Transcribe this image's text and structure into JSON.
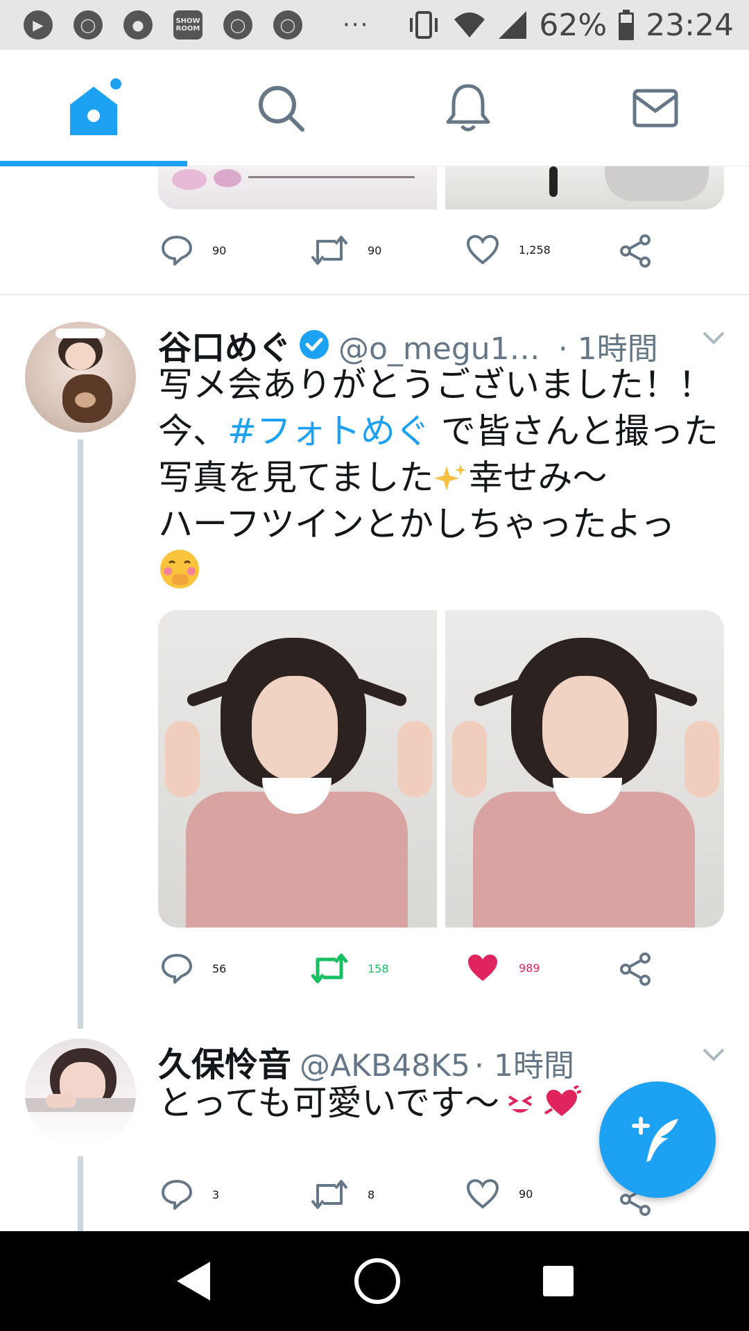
{
  "status_bar": {
    "battery": "62%",
    "time": "23:24",
    "notification_icons": [
      "play-store-icon",
      "chrome-icon",
      "dog-app-icon",
      "showroom-icon",
      "chrome-icon",
      "chrome-icon"
    ],
    "showroom_label": "SHOW ROOM",
    "overflow": "···"
  },
  "tabs": [
    {
      "icon": "home-icon",
      "active": true
    },
    {
      "icon": "search-icon",
      "active": false
    },
    {
      "icon": "bell-icon",
      "active": false
    },
    {
      "icon": "mail-icon",
      "active": false
    }
  ],
  "prev_tweet": {
    "replies": "90",
    "retweets": "90",
    "likes": "1,258"
  },
  "tweet1": {
    "name": "谷口めぐ",
    "verified": true,
    "handle": "@o_megu1…",
    "time": "· 1時間",
    "text_line1": "写メ会ありがとうございました！！",
    "text_line2_pre": "今、",
    "hashtag": "#フォトめぐ",
    "text_line2_post": " で皆さんと撮った",
    "text_line3": "写真を見てました",
    "text_line3_post": "幸せみ〜",
    "text_line4": "ハーフツインとかしちゃったよっ",
    "replies": "56",
    "retweets": "158",
    "likes": "989",
    "retweeted": true,
    "liked": true
  },
  "tweet2": {
    "name": "久保怜音",
    "handle": "@AKB48K5",
    "time": "· 1時間",
    "text": "とっても可愛いです〜",
    "replies": "3",
    "retweets": "8",
    "likes": "90"
  },
  "colors": {
    "accent": "#1da1f2",
    "retweet_green": "#17bf63",
    "like_red": "#e0245e",
    "muted": "#657786"
  }
}
